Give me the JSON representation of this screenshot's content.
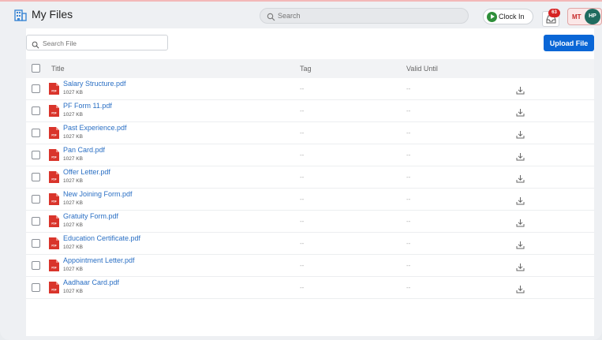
{
  "header": {
    "title": "My Files",
    "search_placeholder": "Search",
    "clock_in_label": "Clock In",
    "notification_count": "63",
    "user_initials_1": "MT",
    "user_initials_2": "HP"
  },
  "toolbar": {
    "file_search_placeholder": "Search File",
    "upload_label": "Upload File"
  },
  "table": {
    "columns": [
      "Title",
      "Tag",
      "Valid Until"
    ],
    "rows": [
      {
        "name": "Salary Structure.pdf",
        "size": "1027 KB",
        "tag": "--",
        "valid_until": "--"
      },
      {
        "name": "PF Form 11.pdf",
        "size": "1027 KB",
        "tag": "--",
        "valid_until": "--"
      },
      {
        "name": "Past Experience.pdf",
        "size": "1027 KB",
        "tag": "--",
        "valid_until": "--"
      },
      {
        "name": "Pan Card.pdf",
        "size": "1027 KB",
        "tag": "--",
        "valid_until": "--"
      },
      {
        "name": "Offer Letter.pdf",
        "size": "1027 KB",
        "tag": "--",
        "valid_until": "--"
      },
      {
        "name": "New Joining Form.pdf",
        "size": "1027 KB",
        "tag": "--",
        "valid_until": "--"
      },
      {
        "name": "Gratuity Form.pdf",
        "size": "1027 KB",
        "tag": "--",
        "valid_until": "--"
      },
      {
        "name": "Education Certificate.pdf",
        "size": "1027 KB",
        "tag": "--",
        "valid_until": "--"
      },
      {
        "name": "Appointment Letter.pdf",
        "size": "1027 KB",
        "tag": "--",
        "valid_until": "--"
      },
      {
        "name": "Aadhaar Card.pdf",
        "size": "1027 KB",
        "tag": "--",
        "valid_until": "--"
      }
    ]
  },
  "colors": {
    "accent": "#0a66d6",
    "link": "#2a6fc4",
    "pdf_icon": "#d9342b",
    "clock_in": "#2f8f3a",
    "badge": "#d62424"
  },
  "icons": {
    "app": "building-icon",
    "search": "search-icon",
    "clock_in": "play-icon",
    "notifications": "inbox-icon",
    "file": "pdf-file-icon",
    "download": "download-icon"
  }
}
